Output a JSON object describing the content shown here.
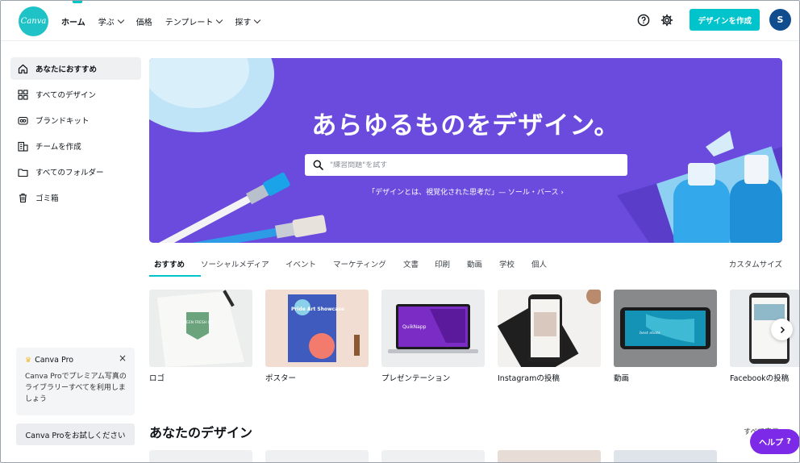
{
  "app": {
    "logo_text": "Canva",
    "brand_color": "#00c4cc"
  },
  "nav": {
    "items": [
      {
        "label": "ホーム"
      },
      {
        "label": "学ぶ"
      },
      {
        "label": "価格"
      },
      {
        "label": "テンプレート"
      },
      {
        "label": "探す"
      }
    ],
    "create_button": "デザインを作成",
    "avatar_initial": "S"
  },
  "sidebar": {
    "items": [
      {
        "label": "あなたにおすすめ",
        "icon": "home-icon"
      },
      {
        "label": "すべてのデザイン",
        "icon": "grid-icon"
      },
      {
        "label": "ブランドキット",
        "icon": "brand-kit-icon"
      },
      {
        "label": "チームを作成",
        "icon": "team-icon"
      },
      {
        "label": "すべてのフォルダー",
        "icon": "folder-icon"
      },
      {
        "label": "ゴミ箱",
        "icon": "trash-icon"
      }
    ],
    "pro_card": {
      "title": "Canva Pro",
      "description": "Canva Proでプレミアム写真のライブラリーすべてを利用しましょう"
    },
    "pro_button": "Canva Proをお試しください"
  },
  "hero": {
    "title": "あらゆるものをデザイン。",
    "search_placeholder": "\"練習問題\"を試す",
    "quote": "「デザインとは、視覚化された思考だ」— ソール・バース ›",
    "background_color": "#6a4bdd"
  },
  "tabs": {
    "items": [
      "おすすめ",
      "ソーシャルメディア",
      "イベント",
      "マーケティング",
      "文書",
      "印刷",
      "動画",
      "学校",
      "個人"
    ],
    "right_label": "カスタムサイズ"
  },
  "templates": [
    {
      "label": "ロゴ",
      "thumb_text": "GREEN FRESH CO."
    },
    {
      "label": "ポスター",
      "thumb_text": "Pride Art Showcase"
    },
    {
      "label": "プレゼンテーション",
      "thumb_text": "QuikNapp"
    },
    {
      "label": "Instagramの投稿"
    },
    {
      "label": "動画",
      "thumb_text": "best shots"
    },
    {
      "label": "Facebookの投稿"
    }
  ],
  "your_designs": {
    "title": "あなたのデザイン",
    "see_all": "すべて表示"
  },
  "help": {
    "label": "ヘルプ",
    "icon": "?"
  }
}
